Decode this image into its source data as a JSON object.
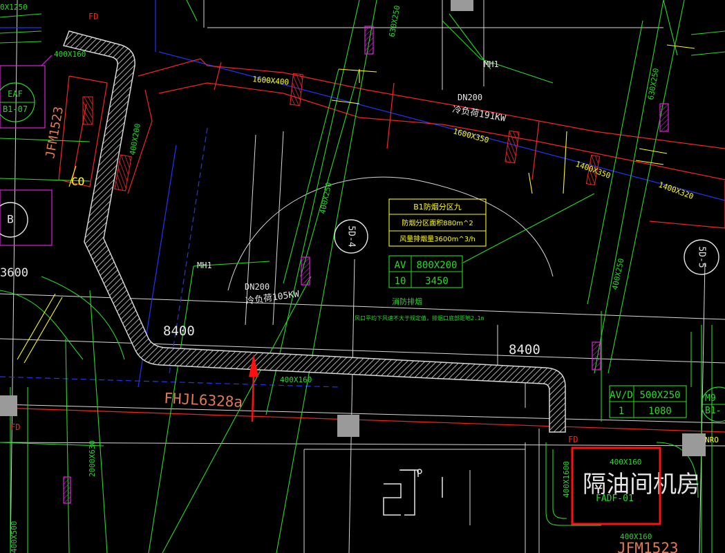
{
  "viewport": {
    "background": "#000000",
    "colors": {
      "red": "#ff2020",
      "green": "#22dd22",
      "white": "#e6e6e6",
      "yellow": "#ffff00",
      "blue": "#2233ff",
      "magenta": "#dd22dd",
      "orange": "#e07a50",
      "duct_hatch": "#d8d8d8",
      "gray_block": "#9a9a9a",
      "highlight": "#ff1010"
    }
  },
  "labels": {
    "t_400x1250": "0X1250",
    "t_fd_top": "FD",
    "t_630x250_top": "630X250",
    "t_400x160_top": "400X160",
    "t_eaf": "EAF",
    "t_b107": "B1-07",
    "t_jfm1523_left": "JFM1523",
    "t_400x200": "400X200",
    "t_col": "CO",
    "t_1600x400": "1600X400",
    "t_mh1_top": "MH1",
    "t_dn200_top": "DN200",
    "t_load191": "冷负荷191KW",
    "t_1600x350": "1600X350",
    "t_1400x350": "1400X350",
    "t_1400x320": "1400X320",
    "t_630x250_right": "630X250",
    "t_400x250_mid": "400X250",
    "t_400x250_right": "400X250",
    "t_5d4": "5D-4",
    "t_5d5": "5D-5",
    "t_3600": "3600",
    "t_mh1_mid": "MH1",
    "t_dn200_mid": "DN200",
    "t_load105": "冷负荷105KW",
    "t_8400_left": "8400",
    "t_8400_right": "8400",
    "t_fire_exhaust": "消防排烟",
    "t_fire_note": "风口平均下风速不大于规定值，排烟口底部距地2.1m",
    "t_400x160_mid": "400X160",
    "t_fhjl": "FHJL6328a",
    "t_fd_left": "FD",
    "t_2000x630": "2000X630",
    "t_400x500": "400X500",
    "t_fd_right": "FD",
    "t_400x160_right": "400X160",
    "t_400x1600": "400X1600",
    "t_room_text": "隔油间机房",
    "t_fadf": "FADF-01",
    "t_400x160_bottom": "400X160",
    "t_jfm1523_bottom": "JFM1523",
    "t_nro": "NRO",
    "t_m9": "M9",
    "t_b1": "B1-"
  },
  "smoke_table": {
    "title": "B1防烟分区九",
    "row1": "防烟分区面积880m^2",
    "row2": "风量排烟量3600m^3/h"
  },
  "av_table_1": {
    "h1": "AV",
    "h2": "800X200",
    "v1": "10",
    "v2": "3450"
  },
  "av_table_2": {
    "h1": "AV/D",
    "h2": "500X250",
    "v1": "1",
    "v2": "1080"
  }
}
